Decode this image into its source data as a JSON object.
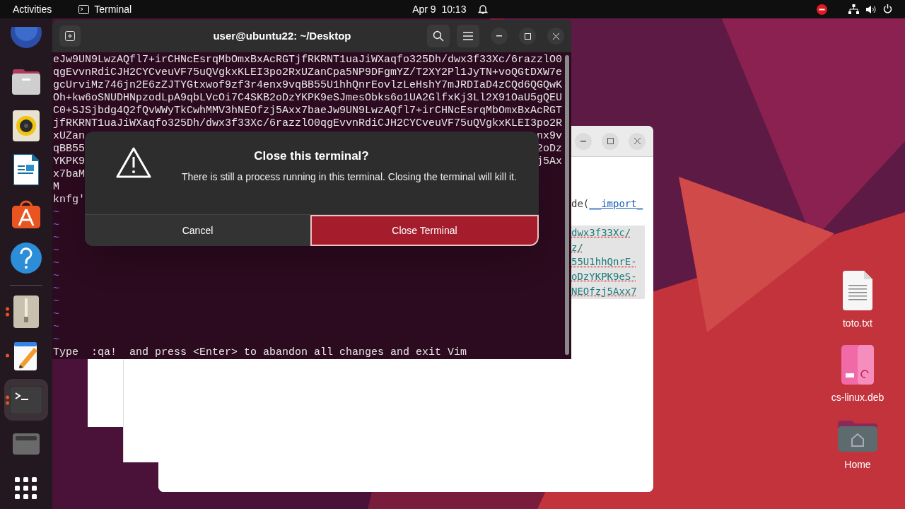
{
  "top_bar": {
    "activities": "Activities",
    "app": "Terminal",
    "clock": "Apr 9  10:13"
  },
  "dock": [
    {
      "kind": "browser",
      "running": false,
      "selected": false
    },
    {
      "kind": "files",
      "running": false,
      "selected": false
    },
    {
      "kind": "music",
      "running": false,
      "selected": false
    },
    {
      "kind": "writer",
      "running": false,
      "selected": false
    },
    {
      "kind": "software",
      "running": false,
      "selected": false
    },
    {
      "kind": "help",
      "running": false,
      "selected": false
    },
    {
      "kind": "separator"
    },
    {
      "kind": "archive",
      "running": true,
      "multiple": true,
      "selected": false
    },
    {
      "kind": "editor",
      "running": true,
      "multiple": false,
      "selected": false
    },
    {
      "kind": "terminal",
      "running": true,
      "multiple": true,
      "selected": true
    },
    {
      "kind": "drive",
      "running": false,
      "selected": false
    },
    {
      "kind": "apps",
      "running": false,
      "selected": false
    }
  ],
  "editor": {
    "lines": [
      {
        "text": "de(",
        "accent": "__import_",
        "highlighted": false
      },
      {
        "text": "dwx3f33Xc/",
        "highlighted": true
      },
      {
        "text": "z/",
        "highlighted": true
      },
      {
        "text": "55U1hhQnrE-",
        "highlighted": true
      },
      {
        "text": "oDzYKPK9eS-",
        "highlighted": true
      },
      {
        "text": "NEOfzj5Axx7",
        "highlighted": true
      }
    ]
  },
  "terminal": {
    "title": "user@ubuntu22: ~/Desktop",
    "lines": [
      {
        "left": "eJw9UN9LwzAQfl7+irCHNcEsrqMbOmxBxAcRGTjfRKRNT1uaJiWXaqfo325Dh/dwx3f33Xc/6razzlO0"
      },
      {
        "left": "qgEvvnRdiCJH2CYCveuVF75uQVgkxKLEI3po2RxUZanCpa5NP9DFgmYZ/T2XY2Pl1JyTN+voQGtDXW7e"
      },
      {
        "left": "gcUrviMz746jn2E6zZJTYGtxwof9zf3r4enx9vqBB55U1hhQnrEovlzLeHshY7mJRDIaD4zCQd6QGQwK"
      },
      {
        "left": "Oh+kw6oSNUDHNpzodLpA9qbLVcOi7C4SKB2oDzYKPK9eSJmesObks6o1UA2GlfxKj3Ll2X91OaU5gQEU"
      },
      {
        "left": "C0+SJSjbdg4Q2fQvWWyTkCwhMMV3hNEOfzj5Axx7baeJw9UN9LwzAQfl7+irCHNcEsrqMbOmxBxAcRGT"
      },
      {
        "left": "jfRKRNT1uaJiWXaqfo325Dh/dwx3f33Xc/6razzlO0qgEvvnRdiCJH2CYCveuVF75uQVgkxKLEI3po2R"
      },
      {
        "left": "xUZan",
        "right": "nx9v"
      },
      {
        "left": "qBB55",
        "right": "2oDz"
      },
      {
        "left": "YKPK9",
        "right": "j5Ax"
      },
      {
        "left": "x7baM"
      },
      {
        "left": "M"
      },
      {
        "left": "knfg'"
      },
      {
        "left": "~",
        "kind": "tilde"
      },
      {
        "left": "~",
        "kind": "tilde"
      },
      {
        "left": "~",
        "kind": "tilde"
      },
      {
        "left": "~",
        "kind": "tilde"
      },
      {
        "left": "~",
        "kind": "tilde"
      },
      {
        "left": "~",
        "kind": "tilde"
      },
      {
        "left": "~",
        "kind": "tilde"
      },
      {
        "left": "~",
        "kind": "tilde"
      },
      {
        "left": "~",
        "kind": "tilde"
      },
      {
        "left": "~",
        "kind": "tilde"
      },
      {
        "left": "~",
        "kind": "tilde"
      },
      {
        "left": "Type  :qa!  and press <Enter> to abandon all changes and exit Vim"
      }
    ]
  },
  "dialog": {
    "title": "Close this terminal?",
    "message": "There is still a process running in this terminal. Closing the terminal will kill it.",
    "buttons": [
      {
        "label": "Cancel",
        "kind": "cancel",
        "focused": false
      },
      {
        "label": "Close Terminal",
        "kind": "destructive",
        "focused": true
      }
    ]
  },
  "desktop_icons": [
    {
      "kind": "text-file",
      "label": "toto.txt"
    },
    {
      "kind": "package",
      "label": "cs-linux.deb"
    },
    {
      "kind": "home",
      "label": "Home"
    }
  ]
}
